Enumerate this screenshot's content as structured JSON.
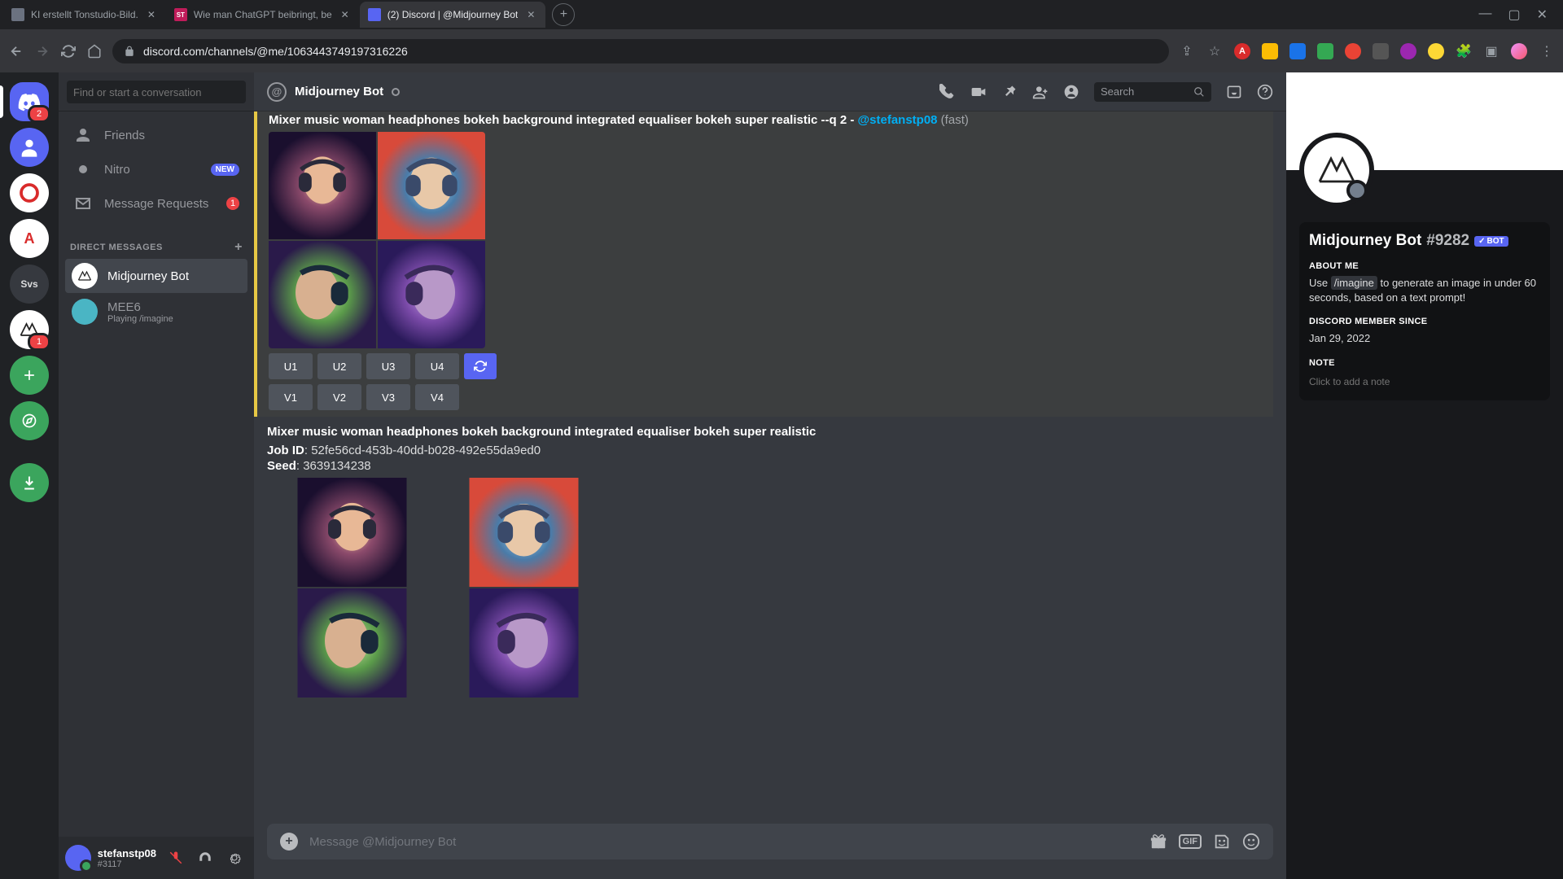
{
  "browser": {
    "tabs": [
      {
        "title": "KI erstellt Tonstudio-Bild.",
        "favicon_bg": "#6b7280",
        "favicon_txt": ""
      },
      {
        "title": "Wie man ChatGPT beibringt, be",
        "favicon_bg": "#c01c5a",
        "favicon_txt": "ST"
      },
      {
        "title": "(2) Discord | @Midjourney Bot",
        "favicon_bg": "#5865f2",
        "favicon_txt": "",
        "active": true
      }
    ],
    "url": "discord.com/channels/@me/1063443749197316226"
  },
  "sidebar": {
    "search_placeholder": "Find or start a conversation",
    "nav": {
      "friends": "Friends",
      "nitro": "Nitro",
      "nitro_badge": "NEW",
      "requests": "Message Requests",
      "requests_count": "1"
    },
    "dm_header": "DIRECT MESSAGES",
    "dms": [
      {
        "name": "Midjourney Bot",
        "selected": true
      },
      {
        "name": "MEE6",
        "status": "Playing /imagine"
      }
    ]
  },
  "user": {
    "name": "stefanstp08",
    "tag": "#3117"
  },
  "chat": {
    "title": "Midjourney Bot",
    "search_placeholder": "Search",
    "msg1": {
      "prompt": "Mixer music woman headphones bokeh background integrated equaliser bokeh super realistic --q 2",
      "sep": " - ",
      "mention": "@stefanstp08",
      "fast": " (fast)",
      "buttons_u": [
        "U1",
        "U2",
        "U3",
        "U4"
      ],
      "buttons_v": [
        "V1",
        "V2",
        "V3",
        "V4"
      ]
    },
    "msg2": {
      "prompt": "Mixer music woman headphones bokeh background integrated equaliser bokeh super realistic",
      "job_label": "Job ID",
      "job_sep": ": ",
      "job_id": "52fe56cd-453b-40dd-b028-492e55da9ed0",
      "seed_label": "Seed",
      "seed_sep": ": ",
      "seed": "3639134238"
    },
    "input_placeholder": "Message @Midjourney Bot"
  },
  "profile": {
    "name": "Midjourney Bot",
    "discrim": "#9282",
    "bot_label": "BOT",
    "about_label": "ABOUT ME",
    "about_pre": "Use ",
    "about_cmd": "/imagine",
    "about_post": " to generate an image in under 60 seconds, based on a text prompt!",
    "member_label": "DISCORD MEMBER SINCE",
    "member_date": "Jan 29, 2022",
    "note_label": "NOTE",
    "note_placeholder": "Click to add a note"
  }
}
